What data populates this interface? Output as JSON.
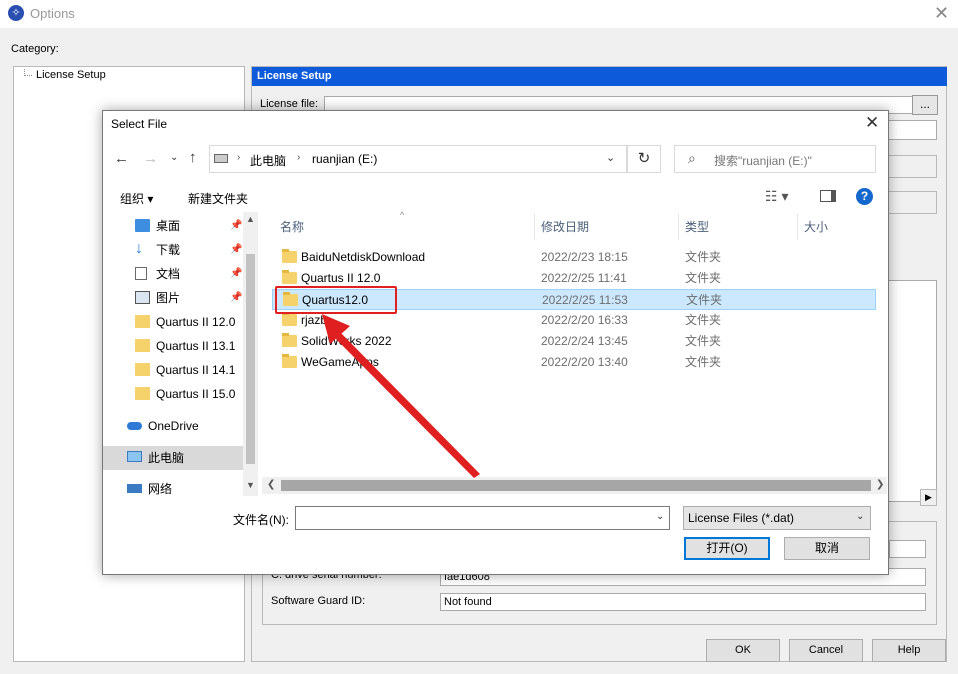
{
  "options_window": {
    "title": "Options",
    "close_glyph": "✕",
    "category_label": "Category:",
    "tree_item": "License Setup",
    "panel_header": "License Setup",
    "license_file_label": "License file:",
    "browse_label": "...",
    "drive_serial_label": "C: drive serial number:",
    "drive_serial_value": "fae1d608",
    "software_guard_label": "Software Guard ID:",
    "software_guard_value": "Not found",
    "ok_label": "OK",
    "cancel_label": "Cancel",
    "help_label": "Help"
  },
  "dialog": {
    "title": "Select File",
    "close_glyph": "✕",
    "breadcrumb": [
      "此电脑",
      "ruanjian (E:)"
    ],
    "search_placeholder": "搜索\"ruanjian (E:)\"",
    "organize_label": "组织 ▾",
    "new_folder_label": "新建文件夹",
    "nav_items": [
      {
        "label": "桌面",
        "icon": "desktop-icon",
        "pinned": true
      },
      {
        "label": "下载",
        "icon": "download-icon",
        "pinned": true
      },
      {
        "label": "文档",
        "icon": "document-icon",
        "pinned": true
      },
      {
        "label": "图片",
        "icon": "picture-icon",
        "pinned": true
      },
      {
        "label": "Quartus II 12.0",
        "icon": "folder-icon",
        "pinned": false
      },
      {
        "label": "Quartus II 13.1",
        "icon": "folder-icon",
        "pinned": false
      },
      {
        "label": "Quartus II 14.1",
        "icon": "folder-icon",
        "pinned": false
      },
      {
        "label": "Quartus II 15.0",
        "icon": "folder-icon",
        "pinned": false
      },
      {
        "label": "OneDrive",
        "icon": "cloud-icon",
        "pinned": false
      },
      {
        "label": "此电脑",
        "icon": "computer-icon",
        "pinned": false
      },
      {
        "label": "网络",
        "icon": "network-icon",
        "pinned": false
      }
    ],
    "columns": {
      "name": "名称",
      "date": "修改日期",
      "type": "类型",
      "size": "大小"
    },
    "files": [
      {
        "name": "BaiduNetdiskDownload",
        "date": "2022/2/23 18:15",
        "type": "文件夹"
      },
      {
        "name": "Quartus II 12.0",
        "date": "2022/2/25 11:41",
        "type": "文件夹"
      },
      {
        "name": "Quartus12.0",
        "date": "2022/2/25 11:53",
        "type": "文件夹"
      },
      {
        "name": "rjazb",
        "date": "2022/2/20 16:33",
        "type": "文件夹"
      },
      {
        "name": "SolidWorks 2022",
        "date": "2022/2/24 13:45",
        "type": "文件夹"
      },
      {
        "name": "WeGameApps",
        "date": "2022/2/20 13:40",
        "type": "文件夹"
      }
    ],
    "selected_file": "Quartus12.0",
    "filename_label": "文件名(N):",
    "filename_value": "",
    "filetype_value": "License Files (*.dat)",
    "open_label": "打开(O)",
    "cancel_label": "取消"
  },
  "annotation": {
    "color": "#e02020"
  }
}
